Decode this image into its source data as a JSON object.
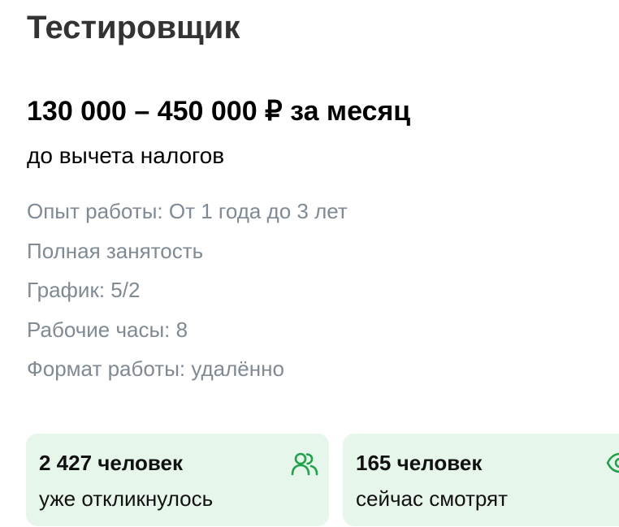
{
  "vacancy": {
    "title": "Тестировщик",
    "salary": "130 000 – 450 000 ₽ за месяц",
    "salary_note": "до вычета налогов"
  },
  "details": [
    "Опыт работы: От 1 года до 3 лет",
    "Полная занятость",
    "График: 5/2",
    "Рабочие часы: 8",
    "Формат работы: удалённо"
  ],
  "stats": {
    "responses": {
      "count": "2 427 человек",
      "label": "уже откликнулось",
      "icon": "people-icon"
    },
    "viewers": {
      "count": "165 человек",
      "label": "сейчас смотрят",
      "icon": "eye-icon"
    }
  },
  "colors": {
    "card_background": "#e7f6ea",
    "accent_green": "#1fa34a",
    "muted_text": "#7f8a94",
    "title_text": "#333333"
  }
}
